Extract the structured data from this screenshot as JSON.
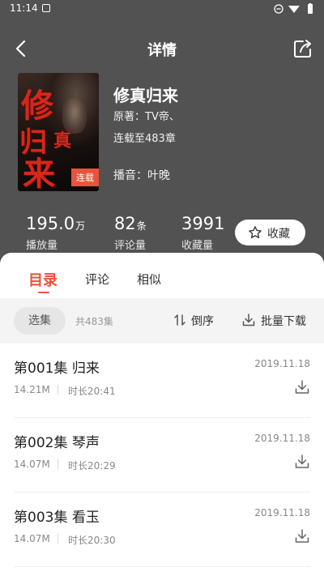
{
  "status_bar": {
    "time": "11:14"
  },
  "header": {
    "title": "详情"
  },
  "book": {
    "cover_text": [
      "修",
      "真",
      "归",
      "来"
    ],
    "badge": "连载",
    "title": "修真归来",
    "author": "原著：TV帝、",
    "progress": "连载至483章",
    "narrator": "播音：叶晚"
  },
  "stats": [
    {
      "value": "195.0",
      "unit": "万",
      "label": "播放量"
    },
    {
      "value": "82",
      "unit": "条",
      "label": "评论量"
    },
    {
      "value": "3991",
      "unit": "",
      "label": "收藏量"
    }
  ],
  "favorite_button": {
    "label": "收藏"
  },
  "tabs": [
    {
      "label": "目录",
      "active": true
    },
    {
      "label": "评论",
      "active": false
    },
    {
      "label": "相似",
      "active": false
    }
  ],
  "toolbar": {
    "select_label": "选集",
    "count": "共483集",
    "sort_label": "倒序",
    "batch_label": "批量下载"
  },
  "episodes": [
    {
      "title": "第001集 归来",
      "date": "2019.11.18",
      "size": "14.21M",
      "duration": "时长20:41"
    },
    {
      "title": "第002集 琴声",
      "date": "2019.11.18",
      "size": "14.07M",
      "duration": "时长20:29"
    },
    {
      "title": "第003集 看玉",
      "date": "2019.11.18",
      "size": "14.07M",
      "duration": "时长20:30"
    }
  ],
  "colors": {
    "accent": "#e8533d",
    "header_bg": "#525252"
  }
}
